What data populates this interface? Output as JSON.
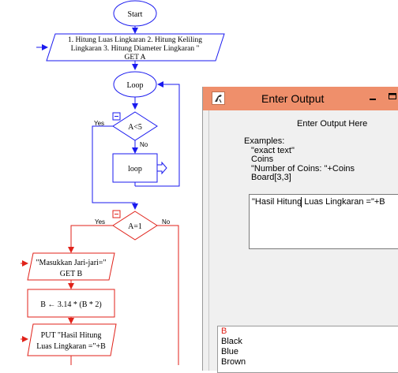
{
  "flowchart": {
    "start": "Start",
    "menu_text": [
      " 1. Hitung Luas Lingkaran 2. Hitung Keliling",
      "Lingkaran 3. Hitung Diameter Lingkaran \"",
      "GET A"
    ],
    "loop_label": "Loop",
    "cond1": "A<5",
    "cond1_yes": "Yes",
    "cond1_no": "No",
    "inner_loop": "loop",
    "cond2": "A=1",
    "cond2_yes": "Yes",
    "cond2_no": "No",
    "input_text": [
      "\"Masukkan Jari-jari=\"",
      "GET B"
    ],
    "assign": "B ← 3.14 * (B * 2)",
    "output_text": [
      "PUT \"Hasil Hitung",
      "Luas Lingkaran =\"+B"
    ],
    "colors": {
      "blue": "#1a1aef",
      "red": "#e0221a"
    }
  },
  "dialog": {
    "title": "Enter Output",
    "prompt": "Enter Output Here",
    "examples_header": "Examples:",
    "examples": [
      "\"exact text\"",
      "Coins",
      "\"Number of Coins: \"+Coins",
      "Board[3,3]"
    ],
    "input_value": "\"Hasil Hitung Luas Lingkaran =\"+B",
    "variables": [
      "B",
      "Black",
      "Blue",
      "Brown"
    ],
    "selected_variable": "B",
    "titlebar_color": "#ef8f6b",
    "icons": {
      "app": "raptor-icon",
      "minimize": "minimize-icon",
      "maximize": "maximize-icon"
    }
  }
}
